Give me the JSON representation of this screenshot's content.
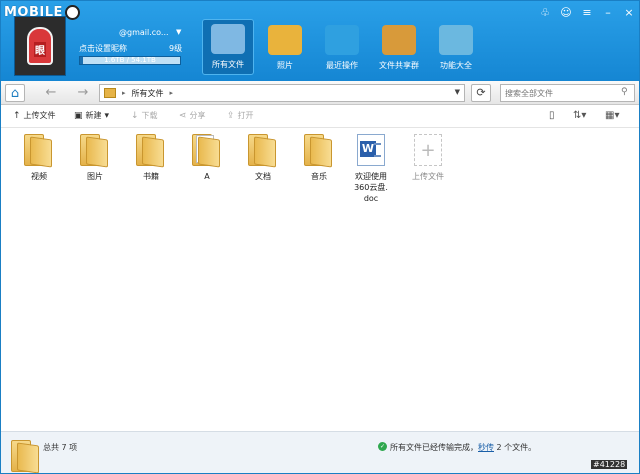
{
  "brand": {
    "logo_text": "MOBILE"
  },
  "window_controls": [
    {
      "name": "shirt-icon",
      "glyph": "♧"
    },
    {
      "name": "skin-icon",
      "glyph": "☺"
    },
    {
      "name": "menu-icon",
      "glyph": "≡"
    },
    {
      "name": "minimize-icon",
      "glyph": "–"
    },
    {
      "name": "close-icon",
      "glyph": "×"
    }
  ],
  "user": {
    "email": "@gmail.co...",
    "settings_link": "点击设置昵称",
    "level": "9级",
    "quota_text": "1.6TB / 54.1TB",
    "quota_fraction": 0.03
  },
  "nav": [
    {
      "label": "所有文件",
      "icon": "all-files-icon",
      "color": "#7fb8e3",
      "active": true
    },
    {
      "label": "照片",
      "icon": "photos-icon",
      "color": "#e9b33c",
      "active": false
    },
    {
      "label": "最近操作",
      "icon": "clock-icon",
      "color": "#2fa0e0",
      "active": false
    },
    {
      "label": "文件共享群",
      "icon": "share-group-icon",
      "color": "#d89a3a",
      "active": false
    },
    {
      "label": "功能大全",
      "icon": "toolbox-icon",
      "color": "#6bb8e0",
      "active": false
    }
  ],
  "address": {
    "path": "所有文件",
    "search_placeholder": "搜索全部文件"
  },
  "toolbar": {
    "upload": "上传文件",
    "new": "新建",
    "download": "下载",
    "share": "分享",
    "open": "打开"
  },
  "files": [
    {
      "name": "视频",
      "type": "folder"
    },
    {
      "name": "图片",
      "type": "folder"
    },
    {
      "name": "书籍",
      "type": "folder"
    },
    {
      "name": "A",
      "type": "folder-paper"
    },
    {
      "name": "文档",
      "type": "folder"
    },
    {
      "name": "音乐",
      "type": "folder"
    },
    {
      "name": "欢迎使用\n360云盘.\ndoc",
      "type": "doc"
    },
    {
      "name": "上传文件",
      "type": "upload"
    }
  ],
  "status": {
    "count": "总共 7 项",
    "message_pre": "所有文件已经传输完成，",
    "message_link": "秒传",
    "message_post": " 2 个文件。",
    "detail": "详细",
    "watermark": "#41228"
  }
}
